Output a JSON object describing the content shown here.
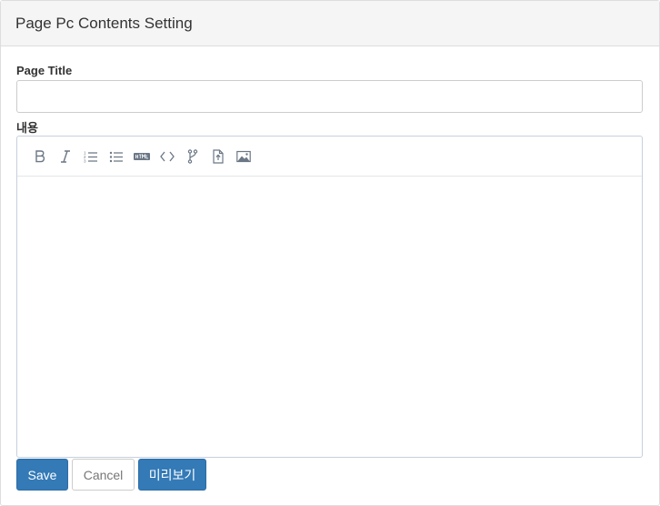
{
  "panel": {
    "heading": "Page Pc Contents Setting"
  },
  "form": {
    "title_label": "Page Title",
    "title_value": "",
    "content_label": "내용"
  },
  "editor": {
    "toolbar": [
      {
        "name": "bold",
        "icon": "bold-icon"
      },
      {
        "name": "italic",
        "icon": "italic-icon"
      },
      {
        "name": "ordered-list",
        "icon": "ordered-list-icon"
      },
      {
        "name": "unordered-list",
        "icon": "unordered-list-icon"
      },
      {
        "name": "html",
        "icon": "html-icon"
      },
      {
        "name": "code",
        "icon": "code-icon"
      },
      {
        "name": "branch",
        "icon": "branch-icon"
      },
      {
        "name": "file-upload",
        "icon": "file-upload-icon"
      },
      {
        "name": "image",
        "icon": "image-icon"
      }
    ],
    "icon_color": "#6b7785"
  },
  "buttons": {
    "save": "Save",
    "cancel": "Cancel",
    "preview": "미리보기"
  },
  "colors": {
    "primary": "#337ab7",
    "heading_bg": "#f5f5f5"
  }
}
